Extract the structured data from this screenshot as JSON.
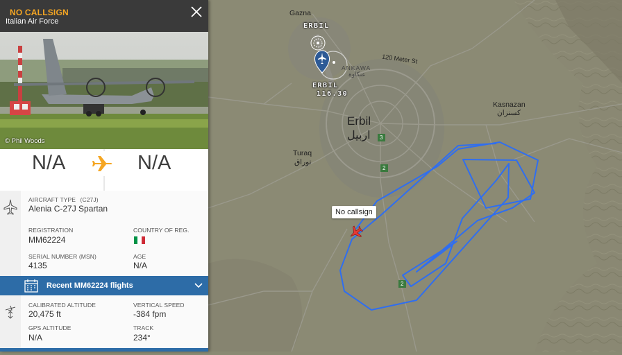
{
  "panel": {
    "callsign": "NO CALLSIGN",
    "airline": "Italian Air Force",
    "photo_credit": "© Phil Woods",
    "origin": "N/A",
    "destination": "N/A",
    "aircraft_type_label": "AIRCRAFT TYPE",
    "aircraft_type_code": "(C27J)",
    "aircraft_type": "Alenia C-27J Spartan",
    "registration_label": "REGISTRATION",
    "registration": "MM62224",
    "country_label": "COUNTRY OF REG.",
    "serial_label": "SERIAL NUMBER (MSN)",
    "serial": "4135",
    "age_label": "AGE",
    "age": "N/A",
    "recent_flights": "Recent MM62224 flights",
    "calibrated_altitude_label": "CALIBRATED ALTITUDE",
    "calibrated_altitude": "20,475 ft",
    "vertical_speed_label": "VERTICAL SPEED",
    "vertical_speed": "-384 fpm",
    "gps_altitude_label": "GPS ALTITUDE",
    "gps_altitude": "N/A",
    "track_label": "TRACK",
    "track": "234°"
  },
  "map": {
    "gazna": "Gazna",
    "erbil_airport": "ERBIL",
    "navaid_name": "ERBIL",
    "navaid_freq": "116.30",
    "street": "120 Meter St",
    "ankawa": "ANKAWA",
    "ankawa_ar": "عنكاوة",
    "city": "Erbil",
    "city_ar": "اربيل",
    "kasnazan": "Kasnazan",
    "kasnazan_ar": "كسنزان",
    "turaq": "Turaq",
    "turaq_ar": "توراق",
    "road_3": "3",
    "road_2a": "2",
    "road_2b": "2",
    "aircraft_label": "No callsign"
  },
  "colors": {
    "callsign": "#f5a623",
    "accent": "#2d6ca7",
    "track_line": "#2f6ef0",
    "aircraft": "#e53935",
    "route_plane": "#f5a623"
  },
  "icons": [
    "close-icon",
    "external-link-icon",
    "plane-icon",
    "aircraft-icon",
    "calendar-icon",
    "chevron-down-icon",
    "altitude-icon",
    "flag-italy-icon",
    "navaid-icon",
    "airport-icon"
  ]
}
